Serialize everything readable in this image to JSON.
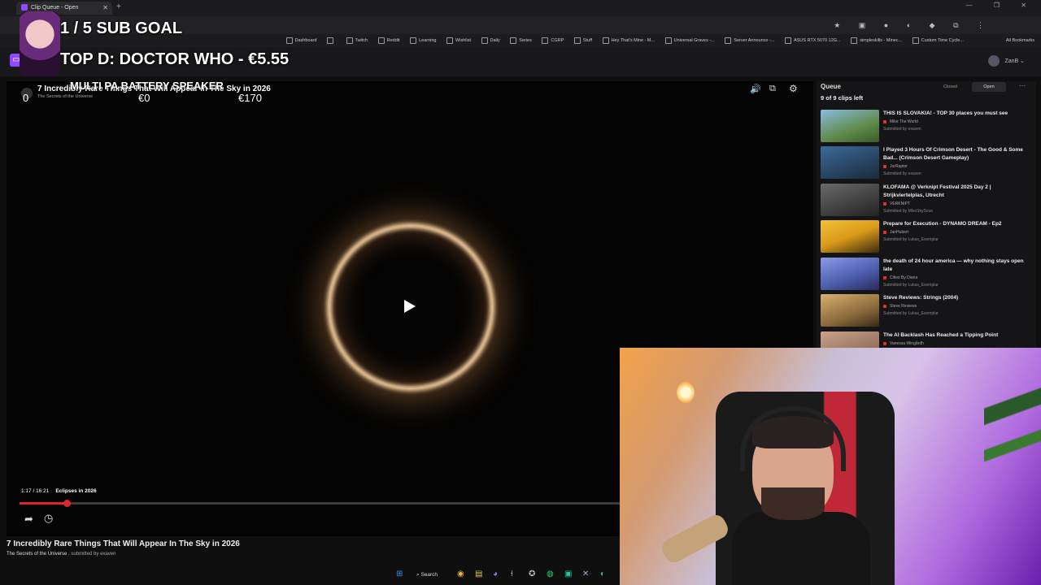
{
  "browser": {
    "tab_title": "Clip Queue - Open",
    "new_tab": "+",
    "window_controls": "— ❐ ✕",
    "bookmarks": [
      "Dashboard",
      "",
      "Twitch",
      "Reddit",
      "Learning",
      "Wishlist",
      "Daily",
      "Series",
      "CGRP",
      "Stuff",
      "Hey That's Mine - M...",
      "Universal Graves -...",
      "Server Announce -...",
      "ASUS RTX 5070 12G...",
      "simpleskills - Minec...",
      "Custom Time Cycle..."
    ],
    "all_bookmarks": "All Bookmarks"
  },
  "app": {
    "user_name": "ZanB"
  },
  "overlay": {
    "sub_goal": "1 / 5 SUB GOAL",
    "top_donation": "TOP D: DOCTOR WHO - €5.55",
    "goal_name": "MULTI PA BATTERY SPEAKER",
    "goal_zero": "0",
    "goal_current": "€0",
    "goal_target": "€170"
  },
  "player": {
    "title": "7 Incredibly Rare Things That Will Appear in The Sky in 2026",
    "channel": "The Secrets of the Universe",
    "time": "1:17 / 16:21",
    "chapter": "Eclipses in 2026",
    "progress": 0.0785
  },
  "below_player": {
    "title": "7 Incredibly Rare Things That Will Appear In The Sky in 2026",
    "channel": "The Secrets of the Universe",
    "submitted_by": ". submitted by exaven"
  },
  "queue": {
    "title": "Queue",
    "closed_label": "Closed",
    "open_label": "Open",
    "clips_left": "9 of 9 clips left",
    "items": [
      {
        "title": "THIS IS SLOVAKIA! - TOP 30 places you must see",
        "channel": "Mike The World",
        "submitted": "Submitted by exaven",
        "thumb": "#5f8a4a"
      },
      {
        "title": "I Played 3 Hours Of Crimson Desert - The Good & Some Bad... (Crimson Desert Gameplay)",
        "channel": "JorRaptor",
        "submitted": "Submitted by exaven",
        "thumb": "#3b6a9a"
      },
      {
        "title": "KLOFAMA @ Verknipt Festival 2025 Day 2 | Strijkviertelplas, Utrecht",
        "channel": "VERKNIPT",
        "submitted": "Submitted by MlsoSkySous",
        "thumb": "#4a4a4a"
      },
      {
        "title": "Prepare for Execution - DYNAMO DREAM - Ep2",
        "channel": "JanHubert",
        "submitted": "Submitted by Lukas_Exemplar",
        "thumb": "#d99a18"
      },
      {
        "title": "the death of 24 hour america — why nothing stays open late",
        "channel": "Cities By Diana",
        "submitted": "Submitted by Lukas_Exemplar",
        "thumb": "#4a5aa8"
      },
      {
        "title": "Steve Reviews: Strings (2004)",
        "channel": "Steve Reviews",
        "submitted": "Submitted by Lukas_Exemplar",
        "thumb": "#8a6a3a"
      },
      {
        "title": "The AI Backlash Has Reached a Tipping Point",
        "channel": "Vanessa Wingårdh",
        "submitted": "",
        "thumb": "#7a5a4a"
      }
    ]
  },
  "taskbar": {
    "search_label": "Search"
  }
}
